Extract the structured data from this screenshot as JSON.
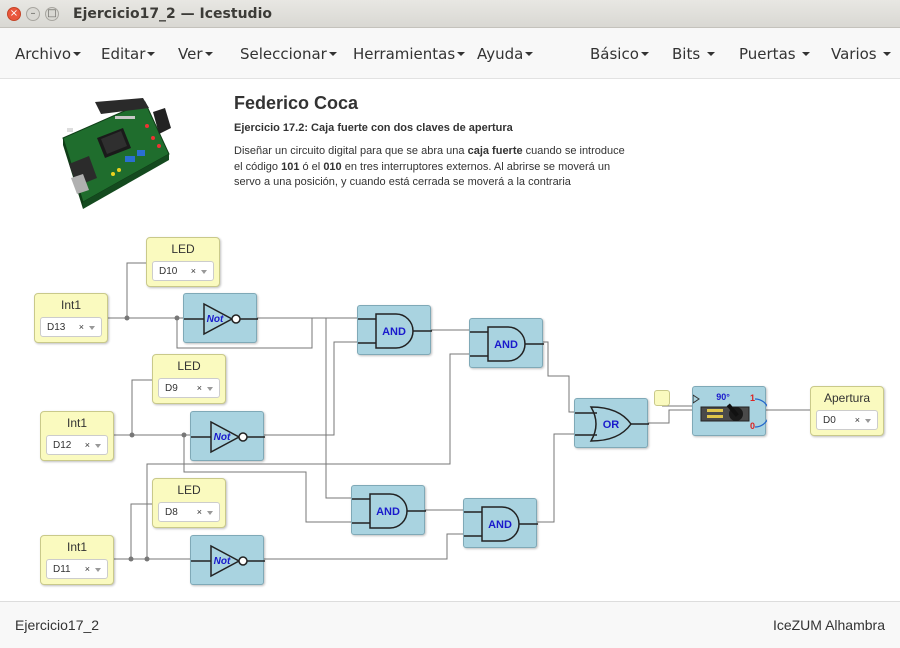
{
  "window": {
    "title": "Ejercicio17_2 — Icestudio",
    "close_glyph": "×",
    "minimize_glyph": "–",
    "maximize_glyph": "□"
  },
  "menu": {
    "left": [
      "Archivo",
      "Editar",
      "Ver",
      "Seleccionar",
      "Herramientas",
      "Ayuda"
    ],
    "right": [
      "Básico",
      "Bits",
      "Puertas",
      "Varios"
    ]
  },
  "info": {
    "author": "Federico Coca",
    "exercise_number": "Ejercicio 17.2",
    "exercise_title": ": Caja fuerte con dos claves de apertura",
    "desc": [
      {
        "t": "Diseñar un circuito digital para que se abra una ",
        "b": false
      },
      {
        "t": "caja fuerte",
        "b": true
      },
      {
        "t": " cuando se introduce el código ",
        "b": false
      },
      {
        "t": "101",
        "b": true
      },
      {
        "t": " ó el ",
        "b": false
      },
      {
        "t": "010",
        "b": true
      },
      {
        "t": " en tres interruptores externos. Al abrirse se moverá un servo a una posición, y cuando está cerrada se moverá a la contraria",
        "b": false
      }
    ]
  },
  "blocks": {
    "inputs": [
      {
        "label": "Int1",
        "pin": "D13"
      },
      {
        "label": "Int1",
        "pin": "D12"
      },
      {
        "label": "Int1",
        "pin": "D11"
      }
    ],
    "leds": [
      {
        "label": "LED",
        "pin": "D10"
      },
      {
        "label": "LED",
        "pin": "D9"
      },
      {
        "label": "LED",
        "pin": "D8"
      }
    ],
    "output": {
      "label": "Apertura",
      "pin": "D0"
    },
    "clear_glyph": "×",
    "not_label": "Not",
    "and_label": "AND",
    "or_label": "OR",
    "servo": {
      "angle": "90°",
      "one": "1",
      "zero": "0"
    }
  },
  "colors": {
    "io_fill": "#fafabf",
    "gate_fill": "#a9d3e0",
    "wire": "#777777",
    "gate_text": "#1a1acc",
    "close_button": "#e9563b"
  },
  "status": {
    "project": "Ejercicio17_2",
    "board": "IceZUM Alhambra"
  }
}
